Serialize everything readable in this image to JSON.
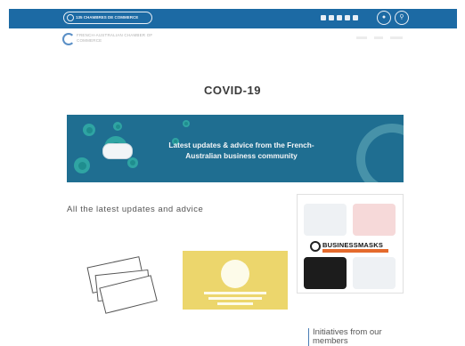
{
  "topbar": {
    "cci_label": "135 CHAMBRES DE COMMERCE",
    "social_icons": [
      "facebook-icon",
      "instagram-icon",
      "facebook-f-icon",
      "twitter-icon",
      "youtube-icon"
    ],
    "account_icon": "user-icon",
    "search_icon": "search-icon",
    "color": "#1c6aa4"
  },
  "header": {
    "logo_text": "FRENCH-AUSTRALIAN CHAMBER OF COMMERCE"
  },
  "page": {
    "title": "COVID-19",
    "hero_text": "Latest updates & advice from the French-Australian business community",
    "section_heading": "All the latest updates and advice"
  },
  "ad": {
    "brand": "BUSINESSMASKS",
    "accent": "#e46a2c"
  },
  "sidebar": {
    "initiatives": "Initiatives from our members"
  }
}
